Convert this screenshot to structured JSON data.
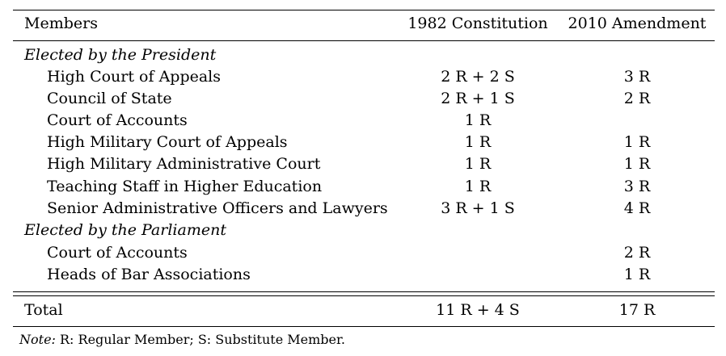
{
  "header": {
    "members": "Members",
    "col_1982": "1982 Constitution",
    "col_2010": "2010 Amendment"
  },
  "sections": [
    {
      "title": "Elected by the President",
      "rows": [
        {
          "member": "High Court of Appeals",
          "c1982": "2 R + 2 S",
          "c2010": "3 R"
        },
        {
          "member": "Council of State",
          "c1982": "2 R + 1 S",
          "c2010": "2 R"
        },
        {
          "member": "Court of Accounts",
          "c1982": "1 R",
          "c2010": ""
        },
        {
          "member": "High Military Court of Appeals",
          "c1982": "1 R",
          "c2010": "1 R"
        },
        {
          "member": "High Military Administrative Court",
          "c1982": "1 R",
          "c2010": "1 R"
        },
        {
          "member": "Teaching Staff in Higher Education",
          "c1982": "1 R",
          "c2010": "3 R"
        },
        {
          "member": "Senior Administrative Officers and Lawyers",
          "c1982": "3 R + 1 S",
          "c2010": "4 R"
        }
      ]
    },
    {
      "title": "Elected by the Parliament",
      "rows": [
        {
          "member": "Court of Accounts",
          "c1982": "",
          "c2010": "2 R"
        },
        {
          "member": "Heads of Bar Associations",
          "c1982": "",
          "c2010": "1 R"
        }
      ]
    }
  ],
  "total": {
    "label": "Total",
    "c1982": "11 R + 4 S",
    "c2010": "17 R"
  },
  "note": {
    "label": "Note:",
    "text": " R: Regular Member; S: Substitute Member."
  }
}
